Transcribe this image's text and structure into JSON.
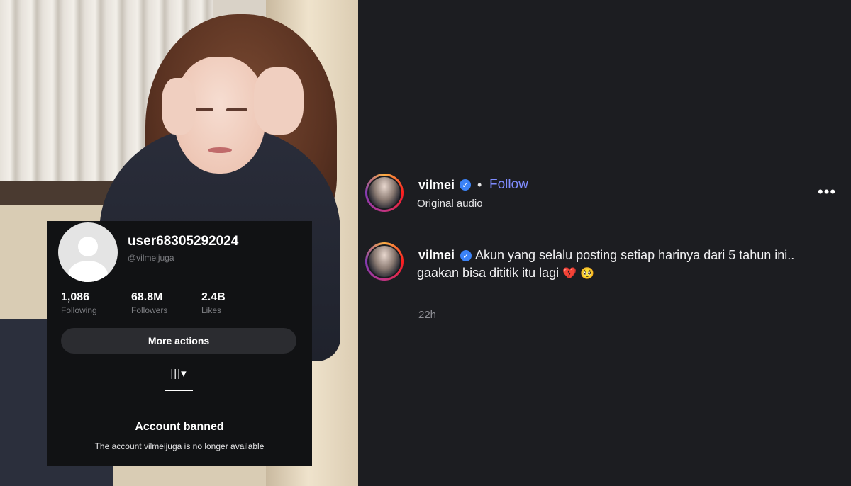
{
  "profile_card": {
    "username": "user68305292024",
    "handle": "@vilmeijuga",
    "stats": [
      {
        "value": "1,086",
        "label": "Following"
      },
      {
        "value": "68.8M",
        "label": "Followers"
      },
      {
        "value": "2.4B",
        "label": "Likes"
      }
    ],
    "more_actions_label": "More actions",
    "grid_tab_glyph": "|||▾",
    "banned_title": "Account banned",
    "banned_message": "The account vilmeijuga is no longer available"
  },
  "post": {
    "author": "vilmei",
    "separator": "•",
    "follow_label": "Follow",
    "audio_label": "Original audio",
    "menu_glyph": "•••",
    "comment_author": "vilmei",
    "caption_line1": "Akun yang selalu posting setiap harinya dari 5 tahun ini..",
    "caption_line2": "gaakan bisa dititik itu lagi",
    "caption_emoji": [
      "💔",
      "🥺"
    ],
    "timestamp": "22h"
  },
  "icons": {
    "verified": "verified-badge-icon",
    "menu": "more-options-icon",
    "grid": "grid-tab-icon",
    "avatar_placeholder": "default-avatar-icon"
  },
  "colors": {
    "panel_background": "#1c1d21",
    "card_background": "#111214",
    "follow_link": "#7f8cff",
    "verified_badge": "#3b82f6",
    "button_background": "#2b2c30"
  }
}
